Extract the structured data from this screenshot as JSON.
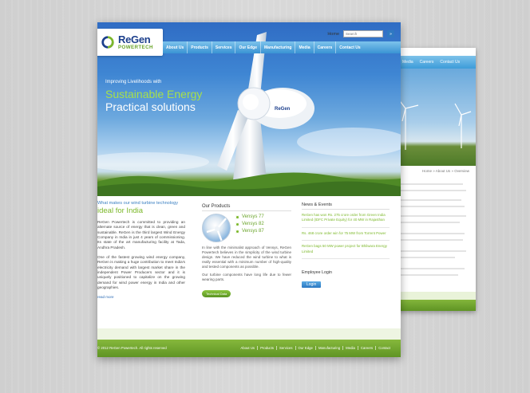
{
  "brand": {
    "name": "ReGen",
    "sub": "POWERTECH"
  },
  "topbar": {
    "home": "Home",
    "search_placeholder": "Search",
    "search_btn": "»"
  },
  "nav": [
    "About Us",
    "Products",
    "Services",
    "Our Edge",
    "Manufacturing",
    "Media",
    "Careers",
    "Contact Us"
  ],
  "banner": {
    "tag_small": "Improving Livelihoods with",
    "tag_green": "Sustainable Energy",
    "tag_white": "Practical solutions",
    "hub_text": "ReGen"
  },
  "col1": {
    "kicker": "What makes our wind turbine technology",
    "headline": "ideal for India",
    "para1": "ReGen Powertech is committed to providing an alternate source of energy that is clean, green and sustainable. ReGen is the third largest Wind Energy Company in India in just 4 years of commissioning. Its state of the art manufacturing facility at Tada, Andhra Pradesh.",
    "para2": "One of the fastest growing wind energy company, ReGen is making a huge contribution to meet India's electricity demand with largest market share in the independent Power Producers sector and it is uniquely positioned to capitalize on the growing demand for wind power energy in India and other geographies.",
    "more": "read more"
  },
  "col2": {
    "title": "Our Products",
    "products": [
      "Vensys 77",
      "Vensys 82",
      "Vensys 87"
    ],
    "para1": "In line with the minimalist approach of Vensys, ReGen Powertech believes in the simplicity of the wind turbine design. We have reduced the wind turbine to what is really essential with a minimum number of high-quality and tested components as possible.",
    "para2": "Our turbine components have long life due to fewer wearing parts.",
    "button": "Technical Data"
  },
  "col3": {
    "title": "News & Events",
    "news": [
      "ReGen has won Rs. 275 crore order from Green India Limited (IDFC Private Equity) for 40 MW in Rajasthan",
      "Rs. 468 crore order win for 75 MW from Torrent Power",
      "ReGen bags 50 MW power project for Bhilwara Energy Limited"
    ],
    "employee_login": "Employee Login",
    "login": "Login"
  },
  "footer": {
    "copyright": "© 2012 ReGen Powertech. All rights reserved",
    "links": [
      "About Us",
      "Products",
      "Services",
      "Our Edge",
      "Manufacturing",
      "Media",
      "Careers",
      "Contact"
    ]
  },
  "back_page": {
    "nav": [
      "Media",
      "Careers",
      "Contact Us"
    ],
    "breadcrumb": "Home » About Us » Overview"
  },
  "colors": {
    "brand_blue": "#1c3f8c",
    "accent_green": "#7cb82a",
    "nav_blue": "#3a93d3",
    "footer_green": "#5f9424"
  }
}
